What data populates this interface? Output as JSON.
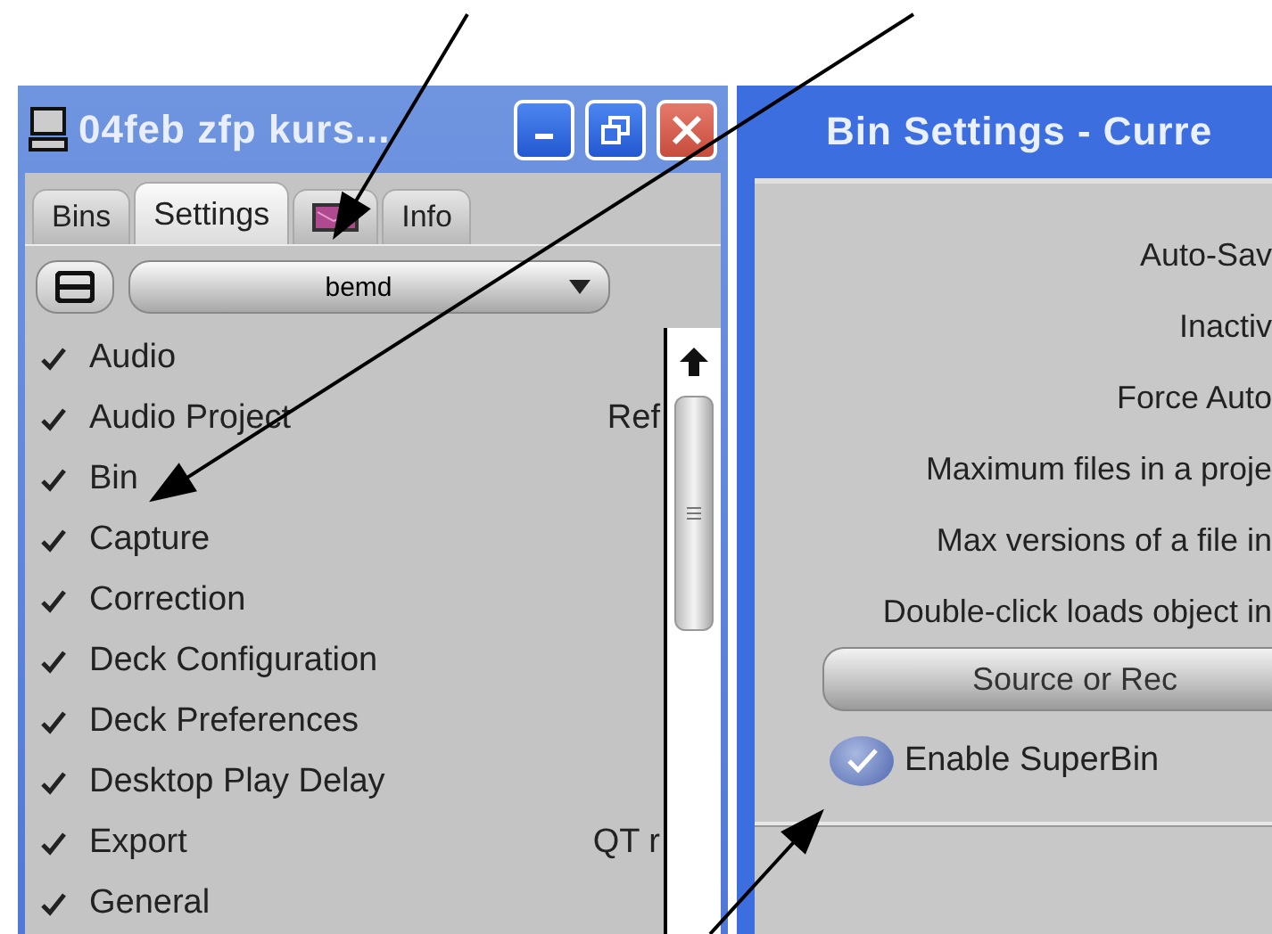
{
  "settings_window": {
    "title": "04feb zfp kurs...",
    "tabs": [
      {
        "kind": "text",
        "label": "Bins",
        "selected": false
      },
      {
        "kind": "text",
        "label": "Settings",
        "selected": true
      },
      {
        "kind": "image",
        "selected": false
      },
      {
        "kind": "text",
        "label": "Info",
        "selected": false
      }
    ],
    "settings_dropdown": {
      "value": "bemd"
    },
    "settings": [
      {
        "name": "Audio",
        "checked": true
      },
      {
        "name": "Audio Project",
        "checked": true,
        "value": "Ref"
      },
      {
        "name": "Bin",
        "checked": true
      },
      {
        "name": "Capture",
        "checked": true
      },
      {
        "name": "Correction",
        "checked": true
      },
      {
        "name": "Deck Configuration",
        "checked": true
      },
      {
        "name": "Deck Preferences",
        "checked": true
      },
      {
        "name": "Desktop Play Delay",
        "checked": true
      },
      {
        "name": "Export",
        "checked": true,
        "value": "QT r"
      },
      {
        "name": "General",
        "checked": true
      }
    ]
  },
  "bin_settings_window": {
    "title": "Bin Settings - Curre",
    "labels": [
      "Auto-Sav",
      "Inactiv",
      "Force Auto",
      "Maximum files in a proje",
      "Max versions of a file in",
      "Double-click loads object in"
    ],
    "load_dropdown": {
      "value": "Source or Rec"
    },
    "enable_superbin": {
      "label": "Enable SuperBin",
      "checked": true
    }
  }
}
